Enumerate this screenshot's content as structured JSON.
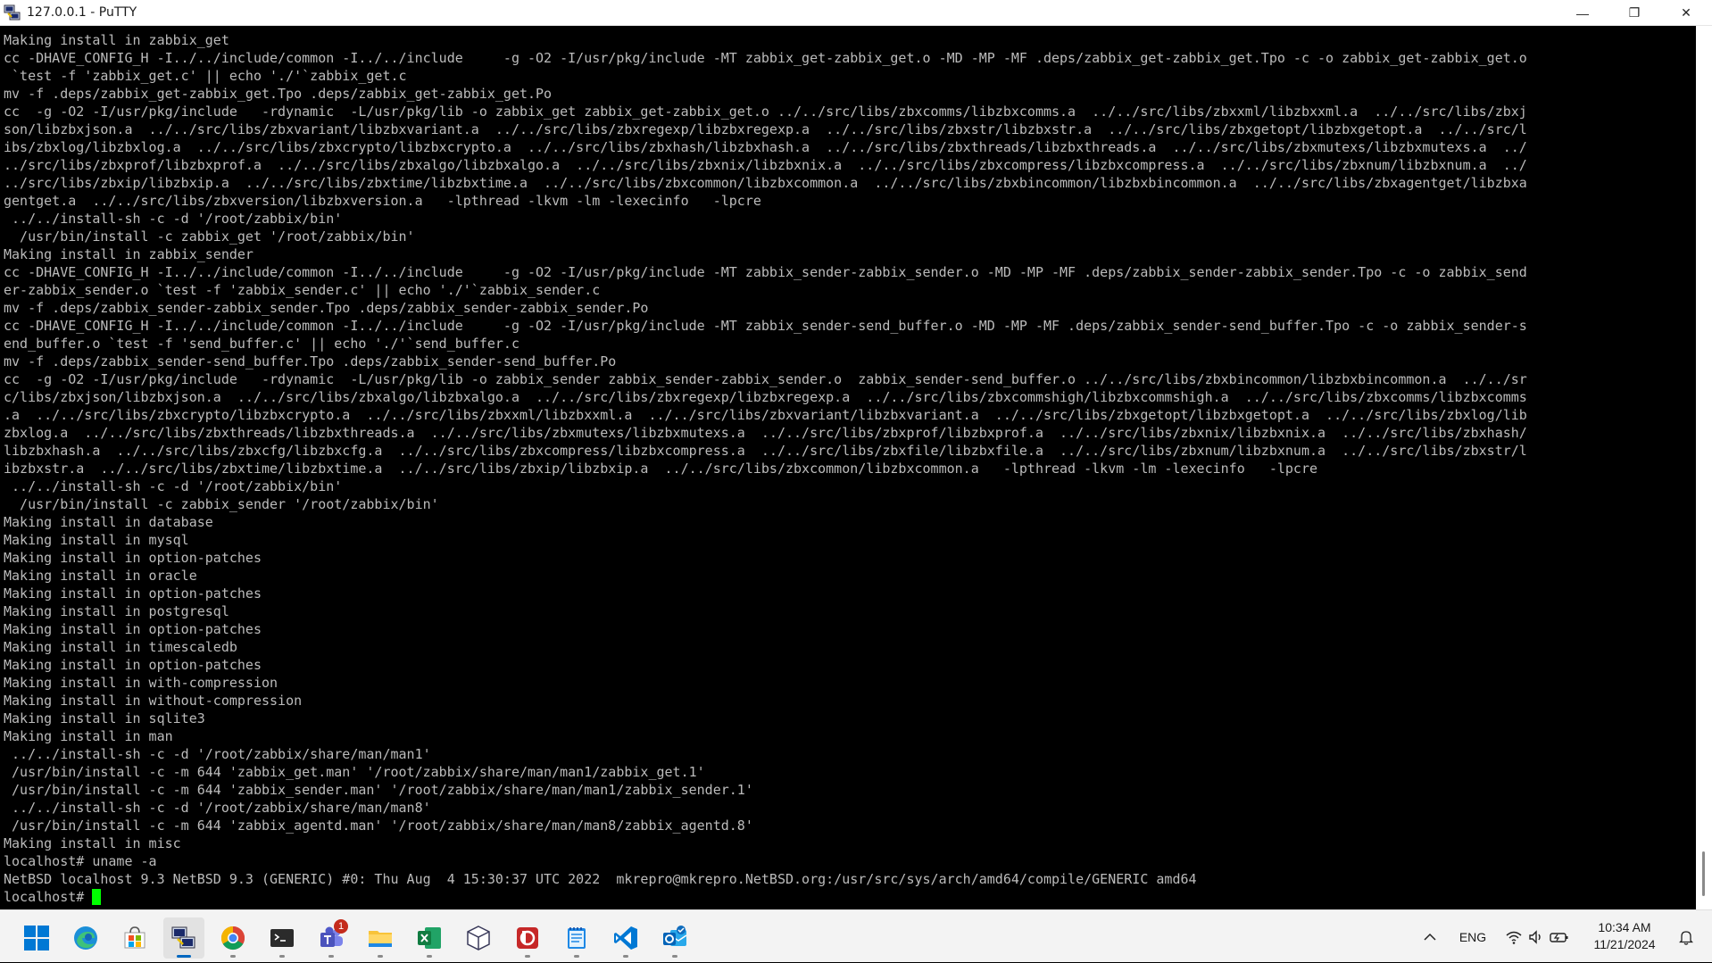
{
  "window": {
    "title": "127.0.0.1 - PuTTY",
    "minimize_glyph": "—",
    "restore_glyph": "❐",
    "close_glyph": "✕"
  },
  "terminal": {
    "lines": [
      "Making install in zabbix_get",
      "cc -DHAVE_CONFIG_H -I../../include/common -I../../include     -g -O2 -I/usr/pkg/include -MT zabbix_get-zabbix_get.o -MD -MP -MF .deps/zabbix_get-zabbix_get.Tpo -c -o zabbix_get-zabbix_get.o",
      " `test -f 'zabbix_get.c' || echo './'`zabbix_get.c",
      "mv -f .deps/zabbix_get-zabbix_get.Tpo .deps/zabbix_get-zabbix_get.Po",
      "cc  -g -O2 -I/usr/pkg/include   -rdynamic  -L/usr/pkg/lib -o zabbix_get zabbix_get-zabbix_get.o ../../src/libs/zbxcomms/libzbxcomms.a  ../../src/libs/zbxxml/libzbxxml.a  ../../src/libs/zbxj",
      "son/libzbxjson.a  ../../src/libs/zbxvariant/libzbxvariant.a  ../../src/libs/zbxregexp/libzbxregexp.a  ../../src/libs/zbxstr/libzbxstr.a  ../../src/libs/zbxgetopt/libzbxgetopt.a  ../../src/l",
      "ibs/zbxlog/libzbxlog.a  ../../src/libs/zbxcrypto/libzbxcrypto.a  ../../src/libs/zbxhash/libzbxhash.a  ../../src/libs/zbxthreads/libzbxthreads.a  ../../src/libs/zbxmutexs/libzbxmutexs.a  ../",
      "../src/libs/zbxprof/libzbxprof.a  ../../src/libs/zbxalgo/libzbxalgo.a  ../../src/libs/zbxnix/libzbxnix.a  ../../src/libs/zbxcompress/libzbxcompress.a  ../../src/libs/zbxnum/libzbxnum.a  ../",
      "../src/libs/zbxip/libzbxip.a  ../../src/libs/zbxtime/libzbxtime.a  ../../src/libs/zbxcommon/libzbxcommon.a  ../../src/libs/zbxbincommon/libzbxbincommon.a  ../../src/libs/zbxagentget/libzbxa",
      "gentget.a  ../../src/libs/zbxversion/libzbxversion.a   -lpthread -lkvm -lm -lexecinfo   -lpcre",
      " ../../install-sh -c -d '/root/zabbix/bin'",
      "  /usr/bin/install -c zabbix_get '/root/zabbix/bin'",
      "Making install in zabbix_sender",
      "cc -DHAVE_CONFIG_H -I../../include/common -I../../include     -g -O2 -I/usr/pkg/include -MT zabbix_sender-zabbix_sender.o -MD -MP -MF .deps/zabbix_sender-zabbix_sender.Tpo -c -o zabbix_send",
      "er-zabbix_sender.o `test -f 'zabbix_sender.c' || echo './'`zabbix_sender.c",
      "mv -f .deps/zabbix_sender-zabbix_sender.Tpo .deps/zabbix_sender-zabbix_sender.Po",
      "cc -DHAVE_CONFIG_H -I../../include/common -I../../include     -g -O2 -I/usr/pkg/include -MT zabbix_sender-send_buffer.o -MD -MP -MF .deps/zabbix_sender-send_buffer.Tpo -c -o zabbix_sender-s",
      "end_buffer.o `test -f 'send_buffer.c' || echo './'`send_buffer.c",
      "mv -f .deps/zabbix_sender-send_buffer.Tpo .deps/zabbix_sender-send_buffer.Po",
      "cc  -g -O2 -I/usr/pkg/include   -rdynamic  -L/usr/pkg/lib -o zabbix_sender zabbix_sender-zabbix_sender.o  zabbix_sender-send_buffer.o ../../src/libs/zbxbincommon/libzbxbincommon.a  ../../sr",
      "c/libs/zbxjson/libzbxjson.a  ../../src/libs/zbxalgo/libzbxalgo.a  ../../src/libs/zbxregexp/libzbxregexp.a  ../../src/libs/zbxcommshigh/libzbxcommshigh.a  ../../src/libs/zbxcomms/libzbxcomms",
      ".a  ../../src/libs/zbxcrypto/libzbxcrypto.a  ../../src/libs/zbxxml/libzbxxml.a  ../../src/libs/zbxvariant/libzbxvariant.a  ../../src/libs/zbxgetopt/libzbxgetopt.a  ../../src/libs/zbxlog/lib",
      "zbxlog.a  ../../src/libs/zbxthreads/libzbxthreads.a  ../../src/libs/zbxmutexs/libzbxmutexs.a  ../../src/libs/zbxprof/libzbxprof.a  ../../src/libs/zbxnix/libzbxnix.a  ../../src/libs/zbxhash/",
      "libzbxhash.a  ../../src/libs/zbxcfg/libzbxcfg.a  ../../src/libs/zbxcompress/libzbxcompress.a  ../../src/libs/zbxfile/libzbxfile.a  ../../src/libs/zbxnum/libzbxnum.a  ../../src/libs/zbxstr/l",
      "ibzbxstr.a  ../../src/libs/zbxtime/libzbxtime.a  ../../src/libs/zbxip/libzbxip.a  ../../src/libs/zbxcommon/libzbxcommon.a   -lpthread -lkvm -lm -lexecinfo   -lpcre",
      " ../../install-sh -c -d '/root/zabbix/bin'",
      "  /usr/bin/install -c zabbix_sender '/root/zabbix/bin'",
      "Making install in database",
      "Making install in mysql",
      "Making install in option-patches",
      "Making install in oracle",
      "Making install in option-patches",
      "Making install in postgresql",
      "Making install in option-patches",
      "Making install in timescaledb",
      "Making install in option-patches",
      "Making install in with-compression",
      "Making install in without-compression",
      "Making install in sqlite3",
      "Making install in man",
      " ../../install-sh -c -d '/root/zabbix/share/man/man1'",
      " /usr/bin/install -c -m 644 'zabbix_get.man' '/root/zabbix/share/man/man1/zabbix_get.1'",
      " /usr/bin/install -c -m 644 'zabbix_sender.man' '/root/zabbix/share/man/man1/zabbix_sender.1'",
      " ../../install-sh -c -d '/root/zabbix/share/man/man8'",
      " /usr/bin/install -c -m 644 'zabbix_agentd.man' '/root/zabbix/share/man/man8/zabbix_agentd.8'",
      "Making install in misc",
      "localhost# uname -a",
      "NetBSD localhost 9.3 NetBSD 9.3 (GENERIC) #0: Thu Aug  4 15:30:37 UTC 2022  mkrepro@mkrepro.NetBSD.org:/usr/src/sys/arch/amd64/compile/GENERIC amd64"
    ],
    "prompt": "localhost# ",
    "text_color": "#bbbbbb",
    "cursor_color": "#00ff00",
    "background": "#000000"
  },
  "taskbar": {
    "apps": [
      {
        "name": "start-button",
        "icon": "windows-logo-icon",
        "active": false,
        "running": false
      },
      {
        "name": "taskbar-edge",
        "icon": "edge-icon",
        "active": false,
        "running": false
      },
      {
        "name": "taskbar-store",
        "icon": "store-icon",
        "active": false,
        "running": false
      },
      {
        "name": "taskbar-putty",
        "icon": "putty-icon",
        "active": true,
        "running": true
      },
      {
        "name": "taskbar-chrome",
        "icon": "chrome-icon",
        "active": false,
        "running": true
      },
      {
        "name": "taskbar-terminal",
        "icon": "terminal-icon",
        "active": false,
        "running": true
      },
      {
        "name": "taskbar-teams",
        "icon": "teams-icon",
        "active": false,
        "running": true,
        "badge": "1"
      },
      {
        "name": "taskbar-explorer",
        "icon": "folder-icon",
        "active": false,
        "running": true
      },
      {
        "name": "taskbar-excel",
        "icon": "excel-icon",
        "active": false,
        "running": true
      },
      {
        "name": "taskbar-virtualbox",
        "icon": "virtualbox-icon",
        "active": false,
        "running": false
      },
      {
        "name": "taskbar-putty-gen",
        "icon": "red-app-icon",
        "active": false,
        "running": true
      },
      {
        "name": "taskbar-notepad",
        "icon": "notepad-icon",
        "active": false,
        "running": true
      },
      {
        "name": "taskbar-vscode",
        "icon": "vscode-icon",
        "active": false,
        "running": true
      },
      {
        "name": "taskbar-outlook",
        "icon": "outlook-icon",
        "active": false,
        "running": true
      }
    ],
    "tray": {
      "chevron": "^",
      "language": "ENG",
      "time": "10:34 AM",
      "date": "11/21/2024"
    },
    "accent": "#0067c0"
  }
}
